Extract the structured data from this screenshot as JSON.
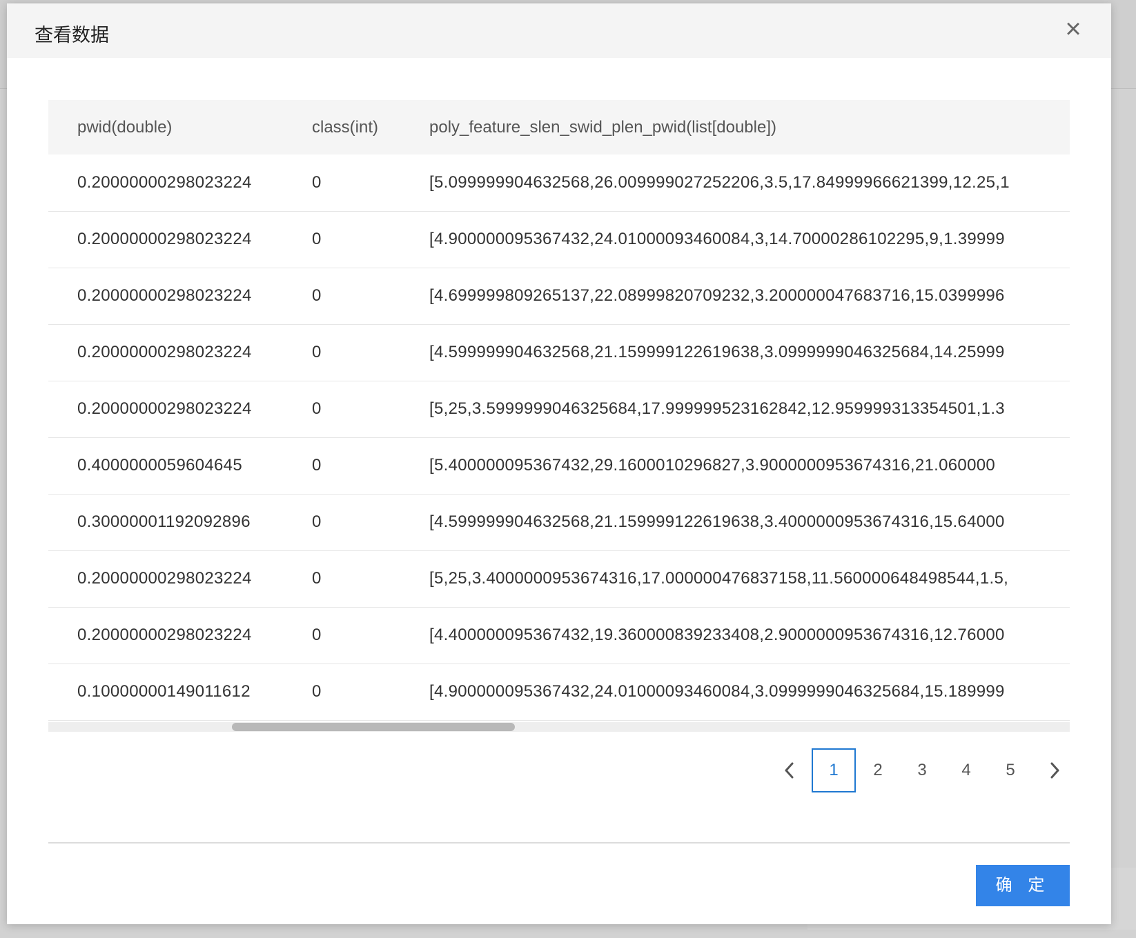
{
  "modal": {
    "title": "查看数据",
    "close_glyph": "×",
    "ok_label": "确 定"
  },
  "table": {
    "columns": [
      "pwid(double)",
      "class(int)",
      "poly_feature_slen_swid_plen_pwid(list[double])"
    ],
    "rows": [
      [
        "0.20000000298023224",
        "0",
        "[5.099999904632568,26.009999027252206,3.5,17.84999966621399,12.25,1"
      ],
      [
        "0.20000000298023224",
        "0",
        "[4.900000095367432,24.01000093460084,3,14.70000286102295,9,1.39999"
      ],
      [
        "0.20000000298023224",
        "0",
        "[4.699999809265137,22.08999820709232,3.200000047683716,15.0399996"
      ],
      [
        "0.20000000298023224",
        "0",
        "[4.599999904632568,21.159999122619638,3.0999999046325684,14.25999"
      ],
      [
        "0.20000000298023224",
        "0",
        "[5,25,3.5999999046325684,17.999999523162842,12.959999313354501,1.3"
      ],
      [
        "0.4000000059604645",
        "0",
        "[5.400000095367432,29.1600010296827,3.9000000953674316,21.060000"
      ],
      [
        "0.30000001192092896",
        "0",
        "[4.599999904632568,21.159999122619638,3.4000000953674316,15.64000"
      ],
      [
        "0.20000000298023224",
        "0",
        "[5,25,3.4000000953674316,17.000000476837158,11.560000648498544,1.5,"
      ],
      [
        "0.20000000298023224",
        "0",
        "[4.400000095367432,19.360000839233408,2.9000000953674316,12.76000"
      ],
      [
        "0.10000000149011612",
        "0",
        "[4.900000095367432,24.01000093460084,3.0999999046325684,15.189999"
      ]
    ]
  },
  "pagination": {
    "pages": [
      "1",
      "2",
      "3",
      "4",
      "5"
    ],
    "current": "1",
    "prev_icon": "chevron-left-icon",
    "next_icon": "chevron-right-icon"
  },
  "colors": {
    "accent": "#3384e8",
    "active_page": "#1f78d1",
    "header_bg": "#f4f4f4"
  }
}
